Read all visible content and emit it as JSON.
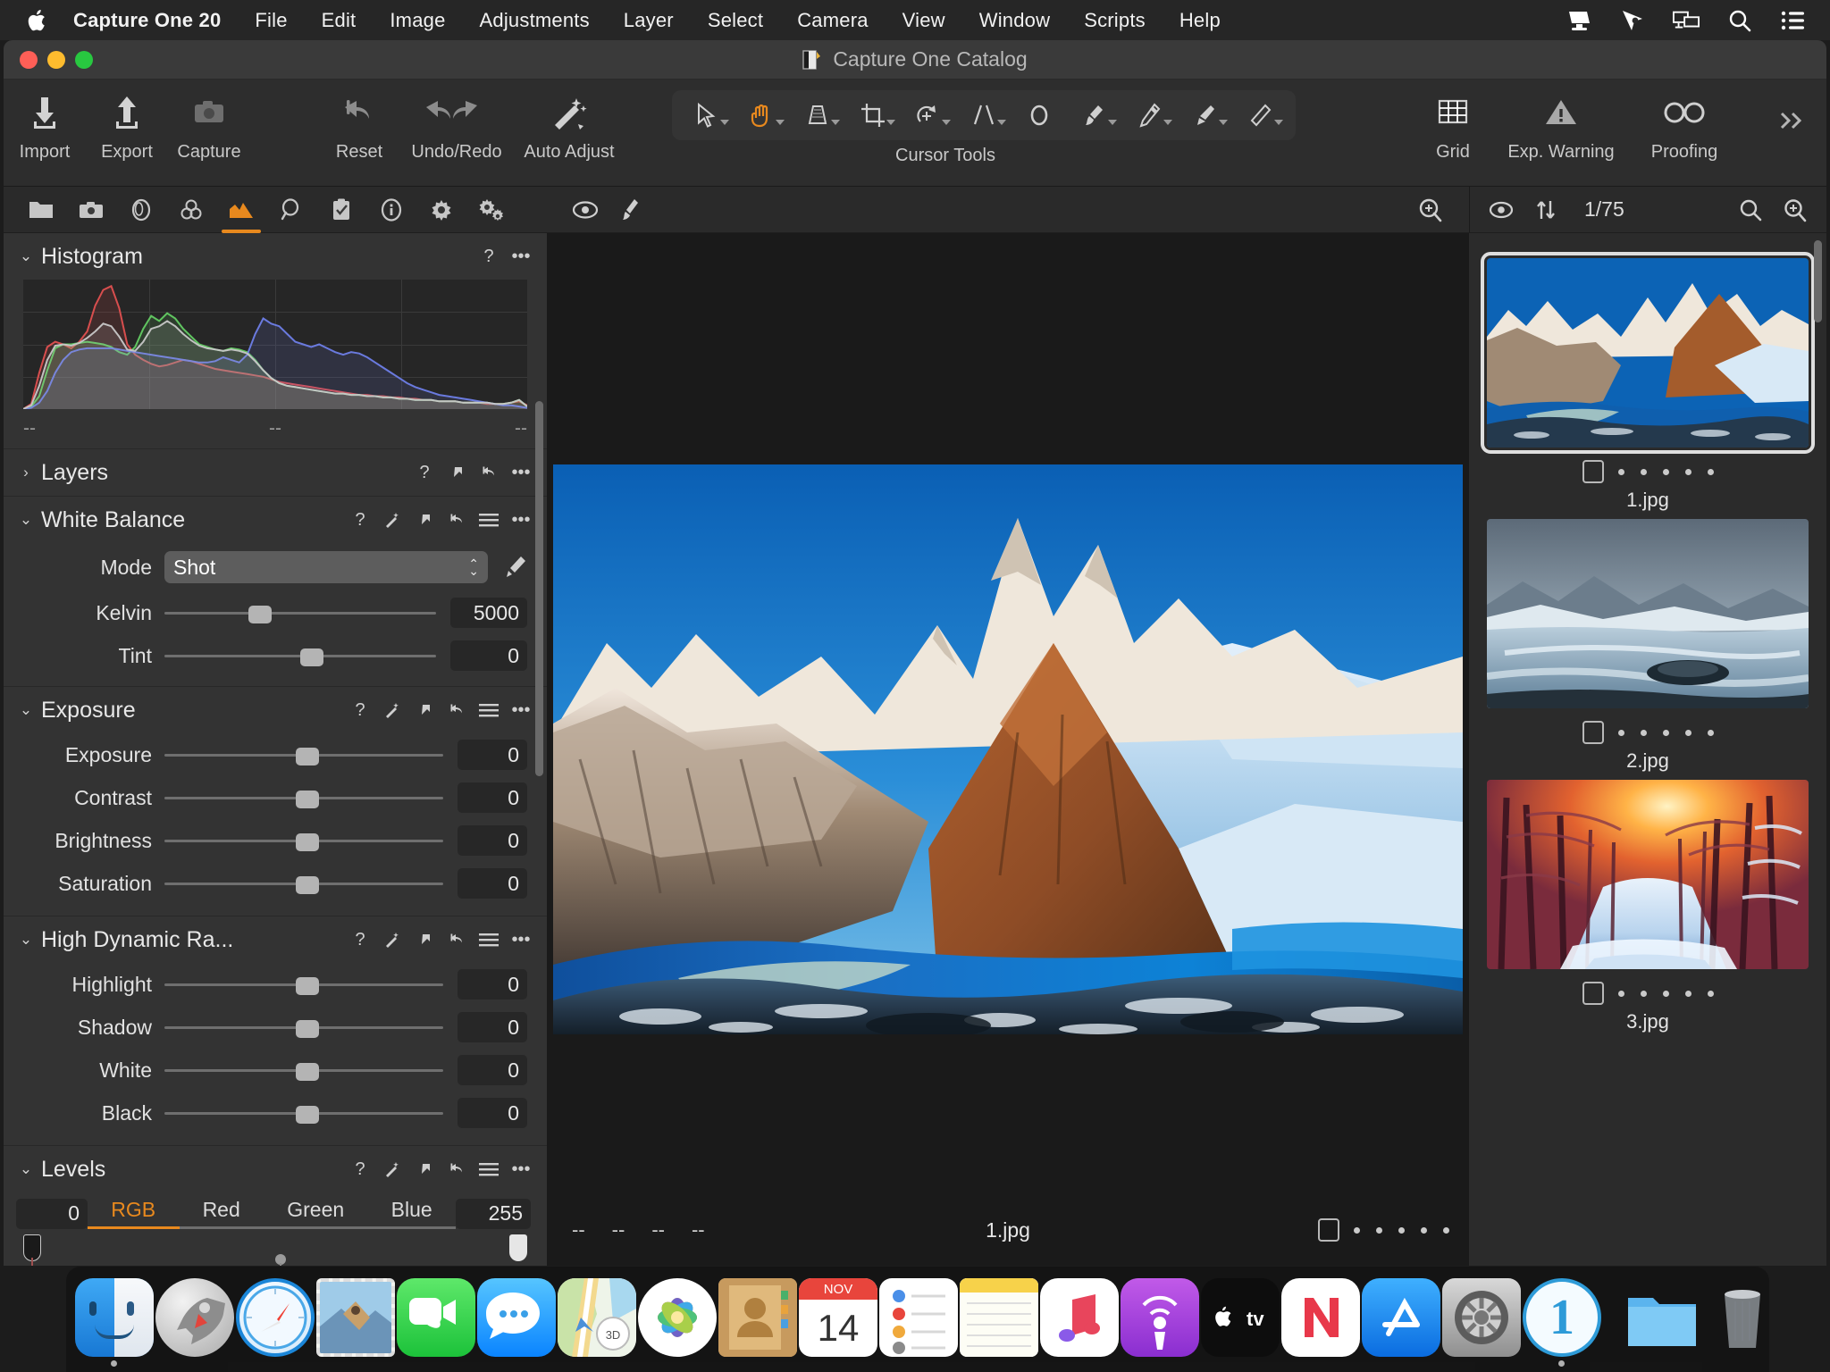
{
  "menubar": {
    "apple_icon": "apple-logo",
    "items": [
      {
        "label": "Capture One 20",
        "bold": true
      },
      {
        "label": "File"
      },
      {
        "label": "Edit"
      },
      {
        "label": "Image"
      },
      {
        "label": "Adjustments"
      },
      {
        "label": "Layer"
      },
      {
        "label": "Select"
      },
      {
        "label": "Camera"
      },
      {
        "label": "View"
      },
      {
        "label": "Window"
      },
      {
        "label": "Scripts"
      },
      {
        "label": "Help"
      }
    ],
    "status_icons": [
      "screen-sharing-icon",
      "cursor-pointer-icon",
      "display-mirror-icon",
      "search-icon",
      "control-center-icon"
    ]
  },
  "window": {
    "title": "Capture One Catalog",
    "traffic_lights": [
      "close-button",
      "minimize-button",
      "maximize-button"
    ]
  },
  "toolbar": {
    "left_buttons": [
      {
        "label": "Import",
        "icon": "import-arrow-down-icon"
      },
      {
        "label": "Export",
        "icon": "export-arrow-up-icon"
      },
      {
        "label": "Capture",
        "icon": "camera-icon"
      }
    ],
    "middle_buttons": [
      {
        "label": "Reset",
        "icon": "reset-arrow-icon"
      },
      {
        "label": "Undo/Redo",
        "icon": "undo-redo-icon"
      },
      {
        "label": "Auto Adjust",
        "icon": "magic-wand-icon"
      }
    ],
    "cursor_tools": {
      "label": "Cursor Tools",
      "active_index": 1,
      "tools": [
        {
          "name": "select-pointer-tool",
          "has_caret": true
        },
        {
          "name": "pan-hand-tool",
          "has_caret": true
        },
        {
          "name": "keystone-tool",
          "has_caret": true
        },
        {
          "name": "crop-tool",
          "has_caret": true
        },
        {
          "name": "rotate-tool",
          "has_caret": true
        },
        {
          "name": "straighten-tool",
          "has_caret": true
        },
        {
          "name": "spot-removal-tool",
          "has_caret": false
        },
        {
          "name": "draw-mask-brush-tool",
          "has_caret": true
        },
        {
          "name": "gradient-mask-tool",
          "has_caret": true
        },
        {
          "name": "erase-mask-tool",
          "has_caret": true
        },
        {
          "name": "heal-brush-tool",
          "has_caret": true
        }
      ]
    },
    "right_buttons": [
      {
        "label": "Grid",
        "icon": "grid-icon"
      },
      {
        "label": "Exp. Warning",
        "icon": "warning-triangle-icon"
      },
      {
        "label": "Proofing",
        "icon": "glasses-icon"
      }
    ],
    "overflow": "chevron-double-right-icon"
  },
  "left_panel": {
    "tabs": [
      {
        "name": "library-tab",
        "icon": "folder-icon",
        "active": false
      },
      {
        "name": "capture-tab",
        "icon": "camera-icon",
        "active": false
      },
      {
        "name": "lens-tab",
        "icon": "lens-icon",
        "active": false
      },
      {
        "name": "color-tab",
        "icon": "color-circles-icon",
        "active": false
      },
      {
        "name": "exposure-tab",
        "icon": "exposure-mountain-icon",
        "active": true
      },
      {
        "name": "details-tab",
        "icon": "magnifier-icon",
        "active": false
      },
      {
        "name": "adjustments-clipboard-tab",
        "icon": "clipboard-check-icon",
        "active": false
      },
      {
        "name": "metadata-tab",
        "icon": "info-circle-icon",
        "active": false
      },
      {
        "name": "output-tab",
        "icon": "gear-icon",
        "active": false
      },
      {
        "name": "batch-tab",
        "icon": "gears-icon",
        "active": false
      }
    ],
    "sections": [
      {
        "id": "histogram",
        "title": "Histogram",
        "expanded": true,
        "icons": [
          "help-icon",
          "more-options-icon"
        ],
        "footer": [
          "--",
          "--",
          "--"
        ]
      },
      {
        "id": "layers",
        "title": "Layers",
        "expanded": false,
        "icons": [
          "help-icon",
          "copy-apply-icon",
          "reset-icon",
          "more-options-icon"
        ]
      },
      {
        "id": "white_balance",
        "title": "White Balance",
        "expanded": true,
        "icons": [
          "help-icon",
          "auto-wand-icon",
          "copy-apply-icon",
          "reset-icon",
          "presets-menu-icon",
          "more-options-icon"
        ],
        "mode_label": "Mode",
        "mode_value": "Shot",
        "picker_icon": "eyedropper-icon",
        "sliders": [
          {
            "label": "Kelvin",
            "value": "5000",
            "pos": 31
          },
          {
            "label": "Tint",
            "value": "0",
            "pos": 50
          }
        ]
      },
      {
        "id": "exposure",
        "title": "Exposure",
        "expanded": true,
        "icons": [
          "help-icon",
          "auto-wand-icon",
          "copy-apply-icon",
          "reset-icon",
          "presets-menu-icon",
          "more-options-icon"
        ],
        "sliders": [
          {
            "label": "Exposure",
            "value": "0",
            "pos": 50
          },
          {
            "label": "Contrast",
            "value": "0",
            "pos": 50
          },
          {
            "label": "Brightness",
            "value": "0",
            "pos": 50
          },
          {
            "label": "Saturation",
            "value": "0",
            "pos": 50
          }
        ]
      },
      {
        "id": "hdr",
        "title": "High Dynamic Ra...",
        "expanded": true,
        "icons": [
          "help-icon",
          "auto-wand-icon",
          "copy-apply-icon",
          "reset-icon",
          "presets-menu-icon",
          "more-options-icon"
        ],
        "sliders": [
          {
            "label": "Highlight",
            "value": "0",
            "pos": 50
          },
          {
            "label": "Shadow",
            "value": "0",
            "pos": 50
          },
          {
            "label": "White",
            "value": "0",
            "pos": 50
          },
          {
            "label": "Black",
            "value": "0",
            "pos": 50
          }
        ]
      },
      {
        "id": "levels",
        "title": "Levels",
        "expanded": true,
        "icons": [
          "help-icon",
          "auto-wand-icon",
          "copy-apply-icon",
          "reset-icon",
          "presets-menu-icon",
          "more-options-icon"
        ],
        "min_value": "0",
        "max_value": "255",
        "channel_tabs": [
          "RGB",
          "Red",
          "Green",
          "Blue"
        ],
        "active_channel": "RGB"
      }
    ]
  },
  "viewer": {
    "toolbar_icons": [
      "viewer-visibility-icon",
      "viewer-brush-icon",
      "zoom-tool-icon"
    ],
    "filename": "1.jpg",
    "meta_dashes": [
      "--",
      "--",
      "--",
      "--"
    ],
    "rating_stars": 5,
    "color_tag_checkbox": "color-tag-box"
  },
  "browser": {
    "toolbar_icons": [
      "browser-visibility-icon",
      "sort-order-icon",
      "browser-search-icon",
      "browser-zoom-icon"
    ],
    "count": "1/75",
    "thumbnails": [
      {
        "filename": "1.jpg",
        "selected": true,
        "stars": 5,
        "scene": "patagonia-mountains"
      },
      {
        "filename": "2.jpg",
        "selected": false,
        "stars": 5,
        "scene": "frozen-lake"
      },
      {
        "filename": "3.jpg",
        "selected": false,
        "stars": 5,
        "scene": "snowy-forest-sunset"
      }
    ]
  },
  "dock": {
    "items": [
      {
        "name": "finder",
        "running": true
      },
      {
        "name": "launchpad",
        "running": false
      },
      {
        "name": "safari",
        "running": false
      },
      {
        "name": "mail",
        "running": false
      },
      {
        "name": "facetime",
        "running": false
      },
      {
        "name": "messages",
        "running": false
      },
      {
        "name": "maps",
        "running": false
      },
      {
        "name": "photos",
        "running": false
      },
      {
        "name": "contacts",
        "running": false
      },
      {
        "name": "calendar",
        "running": false,
        "month": "NOV",
        "day": "14"
      },
      {
        "name": "reminders",
        "running": false
      },
      {
        "name": "notes",
        "running": false
      },
      {
        "name": "music",
        "running": false
      },
      {
        "name": "podcasts",
        "running": false
      },
      {
        "name": "apple-tv",
        "running": false
      },
      {
        "name": "news",
        "running": false
      },
      {
        "name": "app-store",
        "running": false
      },
      {
        "name": "system-preferences",
        "running": false
      },
      {
        "name": "capture-one",
        "running": true
      }
    ],
    "right_items": [
      {
        "name": "downloads-folder"
      },
      {
        "name": "trash"
      }
    ]
  },
  "colors": {
    "accent_orange": "#e8891e",
    "panel_bg": "#333333",
    "toolbar_bg": "#2d2d2d",
    "viewer_bg": "#1a1a1a",
    "text_primary": "#e8e8e8"
  },
  "chart_data": {
    "type": "line",
    "title": "Histogram",
    "xlabel": "",
    "ylabel": "",
    "xlim": [
      0,
      255
    ],
    "ylim": [
      0,
      100
    ],
    "grid": true,
    "series": [
      {
        "name": "Red",
        "color": "#e05050",
        "values": [
          0,
          4,
          28,
          48,
          52,
          50,
          47,
          52,
          60,
          80,
          92,
          95,
          78,
          50,
          42,
          38,
          35,
          33,
          34,
          36,
          38,
          37,
          35,
          33,
          31,
          30,
          29,
          28,
          27,
          26,
          25,
          23,
          21,
          20,
          19,
          18,
          17,
          16,
          15,
          14,
          13,
          12,
          11,
          11,
          10,
          10,
          9,
          9,
          8,
          8,
          7,
          7,
          6,
          6,
          6,
          5,
          5,
          5,
          4,
          4,
          4,
          5,
          6,
          3
        ]
      },
      {
        "name": "Green",
        "color": "#63cc63",
        "values": [
          0,
          2,
          10,
          30,
          47,
          50,
          50,
          51,
          52,
          51,
          50,
          48,
          44,
          42,
          48,
          62,
          72,
          68,
          74,
          70,
          62,
          56,
          50,
          48,
          46,
          45,
          47,
          46,
          44,
          38,
          30,
          24,
          20,
          18,
          17,
          16,
          15,
          14,
          13,
          12,
          12,
          11,
          11,
          10,
          10,
          9,
          9,
          8,
          8,
          7,
          7,
          7,
          6,
          6,
          6,
          5,
          5,
          5,
          5,
          4,
          4,
          5,
          7,
          2
        ]
      },
      {
        "name": "Blue",
        "color": "#6e7ee8",
        "values": [
          0,
          1,
          5,
          14,
          28,
          38,
          44,
          46,
          47,
          47,
          47,
          47,
          46,
          45,
          44,
          43,
          42,
          41,
          40,
          39,
          38,
          37,
          36,
          36,
          37,
          40,
          38,
          36,
          42,
          58,
          70,
          66,
          64,
          58,
          52,
          50,
          48,
          50,
          47,
          44,
          42,
          44,
          43,
          40,
          36,
          32,
          28,
          24,
          20,
          17,
          15,
          13,
          11,
          10,
          9,
          8,
          7,
          6,
          5,
          4,
          3,
          3,
          2,
          1
        ]
      },
      {
        "name": "Luma",
        "color": "#c8c8c8",
        "values": [
          0,
          3,
          18,
          38,
          49,
          50,
          49,
          51,
          55,
          60,
          66,
          64,
          56,
          46,
          45,
          52,
          62,
          64,
          68,
          64,
          58,
          53,
          49,
          47,
          46,
          45,
          46,
          45,
          43,
          37,
          30,
          24,
          20,
          18,
          17,
          16,
          15,
          14,
          13,
          12,
          12,
          11,
          11,
          10,
          10,
          9,
          9,
          8,
          8,
          7,
          7,
          7,
          6,
          6,
          6,
          5,
          5,
          5,
          5,
          4,
          4,
          5,
          7,
          2
        ]
      }
    ]
  }
}
